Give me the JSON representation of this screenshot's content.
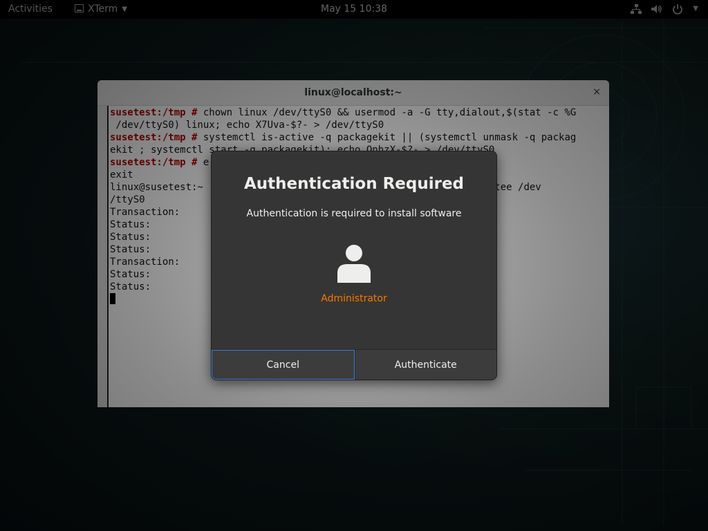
{
  "topbar": {
    "activities": "Activities",
    "app_name": "XTerm",
    "clock": "May 15  10:38",
    "tray_icons": [
      "network-icon",
      "volume-icon",
      "power-icon",
      "chevron-down-icon"
    ]
  },
  "terminal": {
    "title": "linux@localhost:~",
    "close": "×",
    "lines": [
      {
        "prompt": "susetest:/tmp # ",
        "text": "chown linux /dev/ttyS0 && usermod -a -G tty,dialout,$(stat -c %G"
      },
      {
        "prompt": "",
        "text": " /dev/ttyS0) linux; echo X7Uva-$?- > /dev/ttyS0"
      },
      {
        "prompt": "susetest:/tmp # ",
        "text": "systemctl is-active -q packagekit || (systemctl unmask -q packag"
      },
      {
        "prompt": "",
        "text": "ekit ; systemctl start -q packagekit); echo QnhzX-$?- > /dev/ttyS0"
      },
      {
        "prompt": "susetest:/tmp # ",
        "text": "e"
      },
      {
        "prompt": "",
        "text": "exit"
      },
      {
        "prompt": "",
        "text": "linux@susetest:~                                        atus-$? | tee /dev"
      },
      {
        "prompt": "",
        "text": "/ttyS0"
      },
      {
        "prompt": "",
        "text": "Transaction:    "
      },
      {
        "prompt": "",
        "text": "Status:         "
      },
      {
        "prompt": "",
        "text": "Status:         "
      },
      {
        "prompt": "",
        "text": "Status:         "
      },
      {
        "prompt": "",
        "text": "Transaction:    "
      },
      {
        "prompt": "",
        "text": "Status:         "
      },
      {
        "prompt": "",
        "text": "Status:         "
      }
    ]
  },
  "dialog": {
    "heading": "Authentication Required",
    "message": "Authentication is required to install software",
    "user": "Administrator",
    "cancel_label": "Cancel",
    "authenticate_label": "Authenticate",
    "accent_color": "#f57900",
    "focus_color": "#3584e4"
  }
}
